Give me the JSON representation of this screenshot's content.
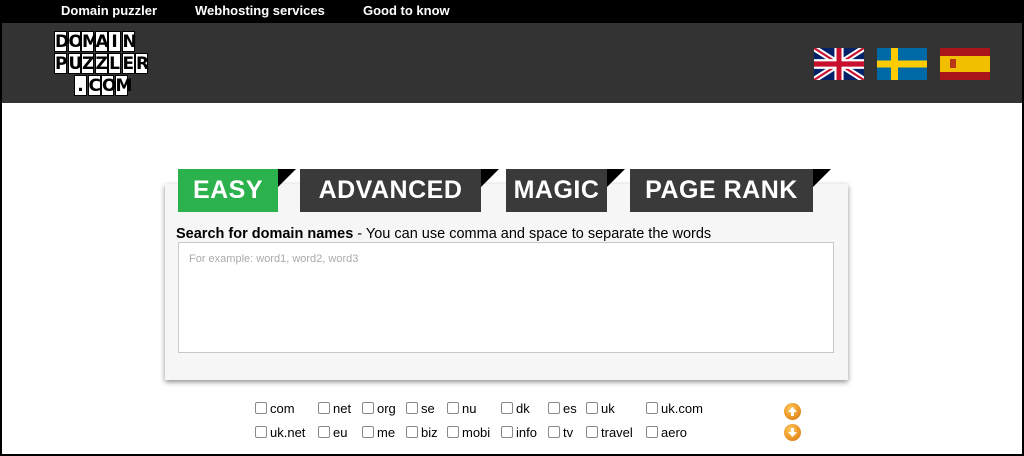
{
  "nav": {
    "items": [
      {
        "label": "Domain puzzler"
      },
      {
        "label": "Webhosting services"
      },
      {
        "label": "Good to know"
      }
    ]
  },
  "logo": {
    "rows": [
      "DOMAIN",
      "PUZZLER",
      ".COM"
    ]
  },
  "flags": [
    {
      "icon": "uk-flag-icon",
      "colors": [
        "#012169",
        "#ffffff",
        "#c8102e"
      ]
    },
    {
      "icon": "sweden-flag-icon",
      "colors": [
        "#006aa7",
        "#fecc00"
      ]
    },
    {
      "icon": "spain-flag-icon",
      "colors": [
        "#aa151b",
        "#f1bf00"
      ]
    }
  ],
  "tabs": [
    {
      "label": "EASY",
      "active": true,
      "color": "#2bb24c"
    },
    {
      "label": "ADVANCED",
      "active": false,
      "color": "#3a3a3a"
    },
    {
      "label": "MAGIC",
      "active": false,
      "color": "#3a3a3a"
    },
    {
      "label": "PAGE RANK",
      "active": false,
      "color": "#3a3a3a"
    }
  ],
  "search": {
    "label_bold": "Search for domain names",
    "label_rest": " - You can use comma and space to separate the words",
    "value": "",
    "placeholder": "For example: word1, word2, word3"
  },
  "tlds": {
    "row1": [
      {
        "label": "com",
        "checked": false
      },
      {
        "label": "net",
        "checked": false
      },
      {
        "label": "org",
        "checked": false
      },
      {
        "label": "se",
        "checked": false
      },
      {
        "label": "nu",
        "checked": false
      },
      {
        "label": "dk",
        "checked": false
      },
      {
        "label": "es",
        "checked": false
      },
      {
        "label": "uk",
        "checked": false
      },
      {
        "label": "uk.com",
        "checked": false
      }
    ],
    "row2": [
      {
        "label": "uk.net",
        "checked": false
      },
      {
        "label": "eu",
        "checked": false
      },
      {
        "label": "me",
        "checked": false
      },
      {
        "label": "biz",
        "checked": false
      },
      {
        "label": "mobi",
        "checked": false
      },
      {
        "label": "info",
        "checked": false
      },
      {
        "label": "tv",
        "checked": false
      },
      {
        "label": "travel",
        "checked": false
      },
      {
        "label": "aero",
        "checked": false
      }
    ]
  },
  "scroll_arrows": [
    {
      "icon": "arrow-up-icon"
    },
    {
      "icon": "arrow-down-icon"
    }
  ]
}
